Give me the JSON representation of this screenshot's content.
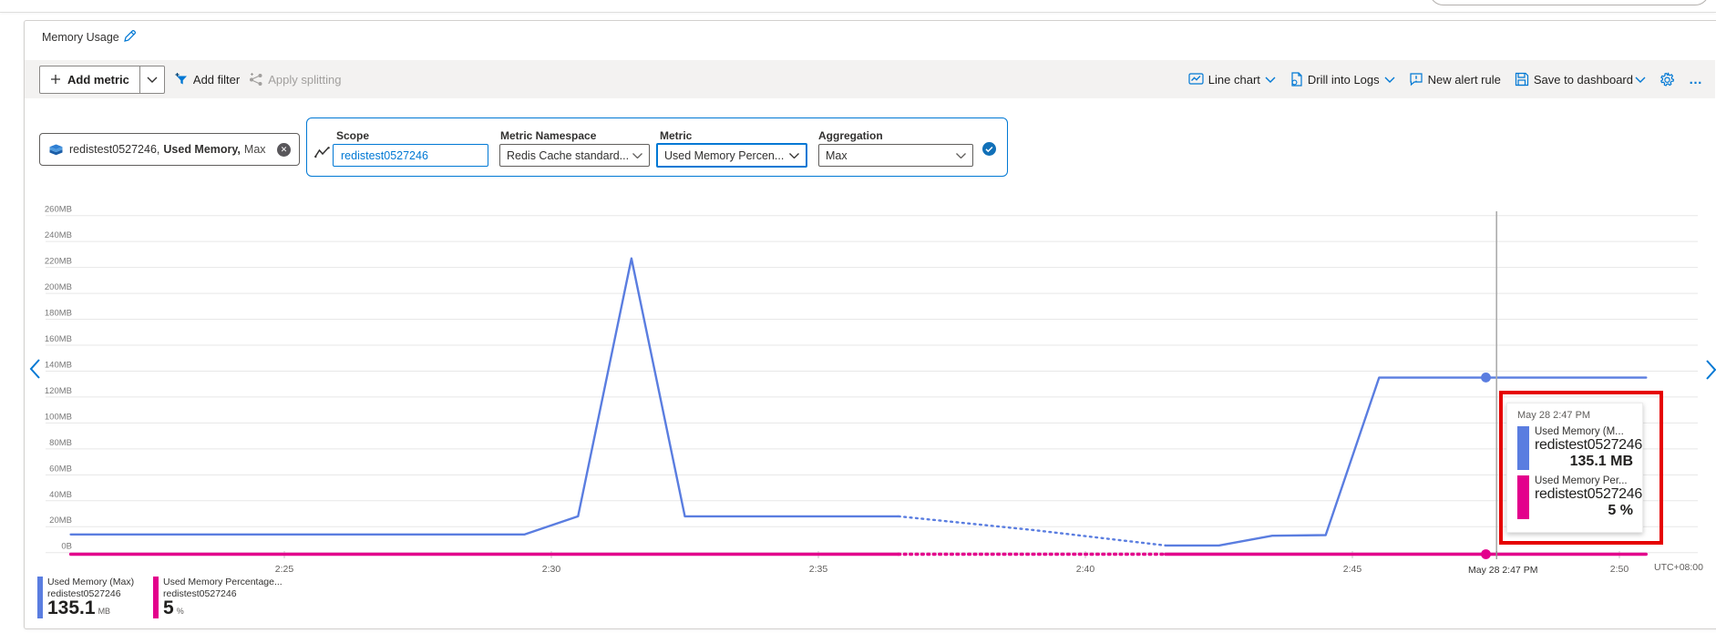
{
  "chart_card": {
    "title": "Memory Usage",
    "toolbar": {
      "add_metric": "Add metric",
      "add_filter": "Add filter",
      "apply_splitting": "Apply splitting",
      "line_chart": "Line chart",
      "drill_into_logs": "Drill into Logs",
      "new_alert_rule": "New alert rule",
      "save_to_dashboard": "Save to dashboard"
    },
    "metric_pill": {
      "resource": "redistest0527246,",
      "metric": "Used Memory,",
      "aggregation": "Max"
    },
    "editor": {
      "scope_label": "Scope",
      "scope_value": "redistest0527246",
      "namespace_label": "Metric Namespace",
      "namespace_value": "Redis Cache standard...",
      "metric_label": "Metric",
      "metric_value": "Used Memory Percen...",
      "aggregation_label": "Aggregation",
      "aggregation_value": "Max"
    },
    "legend": [
      {
        "label": "Used Memory (Max)",
        "resource": "redistest0527246",
        "value": "135.1",
        "unit": "MB",
        "color": "#5a7de0"
      },
      {
        "label": "Used Memory Percentage...",
        "resource": "redistest0527246",
        "value": "5",
        "unit": "%",
        "color": "#e3008c"
      }
    ],
    "tooltip": {
      "timestamp": "May 28 2:47 PM",
      "rows": [
        {
          "label": "Used Memory (M...",
          "resource": "redistest0527246",
          "value": "135.1 MB",
          "color": "#5a7de0"
        },
        {
          "label": "Used Memory Per...",
          "resource": "redistest0527246",
          "value": "5 %",
          "color": "#e3008c"
        }
      ]
    },
    "chart_data": {
      "type": "line",
      "title": "Memory Usage",
      "y_axis": {
        "unit": "MB",
        "min": 0,
        "max": 260,
        "step": 20,
        "ticks": [
          "0B",
          "20MB",
          "40MB",
          "60MB",
          "80MB",
          "100MB",
          "120MB",
          "140MB",
          "160MB",
          "180MB",
          "200MB",
          "220MB",
          "240MB",
          "260MB"
        ]
      },
      "x_axis": {
        "ticks": [
          {
            "label": "2:25",
            "minute": 1
          },
          {
            "label": "2:30",
            "minute": 6
          },
          {
            "label": "2:35",
            "minute": 11
          },
          {
            "label": "2:40",
            "minute": 16
          },
          {
            "label": "2:45",
            "minute": 21
          },
          {
            "label": "2:50",
            "minute": 26
          }
        ],
        "timezone": "UTC+08:00"
      },
      "cursor": {
        "label": "May 28 2:47 PM",
        "minute": 23.7
      },
      "series": [
        {
          "name": "Used Memory (Max)",
          "resource": "redistest0527246",
          "color": "#5a7de0",
          "unit": "MB",
          "marker": {
            "minute": 23.5,
            "value": 135.1
          },
          "segments": [
            {
              "style": "solid",
              "points": [
                [
                  -3,
                  14
                ],
                [
                  5.5,
                  14
                ],
                [
                  6.5,
                  28
                ],
                [
                  7.5,
                  227
                ],
                [
                  8.5,
                  28
                ],
                [
                  12.5,
                  28
                ]
              ]
            },
            {
              "style": "dotted",
              "points": [
                [
                  12.5,
                  28
                ],
                [
                  15,
                  17.5
                ],
                [
                  17.5,
                  5.5
                ]
              ]
            },
            {
              "style": "solid",
              "points": [
                [
                  17.5,
                  5.5
                ],
                [
                  18.5,
                  5.5
                ],
                [
                  19.5,
                  13
                ],
                [
                  20.5,
                  13.5
                ],
                [
                  21.5,
                  135
                ],
                [
                  26.5,
                  135
                ]
              ]
            }
          ]
        },
        {
          "name": "Used Memory Percentage...",
          "resource": "redistest0527246",
          "color": "#e3008c",
          "unit": "%",
          "marker": {
            "minute": 23.5,
            "value": 5
          },
          "segments": [
            {
              "style": "solid",
              "points": [
                [
                  -3,
                  5
                ],
                [
                  12.5,
                  5
                ]
              ]
            },
            {
              "style": "dotted",
              "points": [
                [
                  12.5,
                  5
                ],
                [
                  17.5,
                  5
                ]
              ]
            },
            {
              "style": "solid",
              "points": [
                [
                  17.5,
                  5
                ],
                [
                  26.5,
                  5
                ]
              ]
            }
          ]
        }
      ]
    }
  }
}
